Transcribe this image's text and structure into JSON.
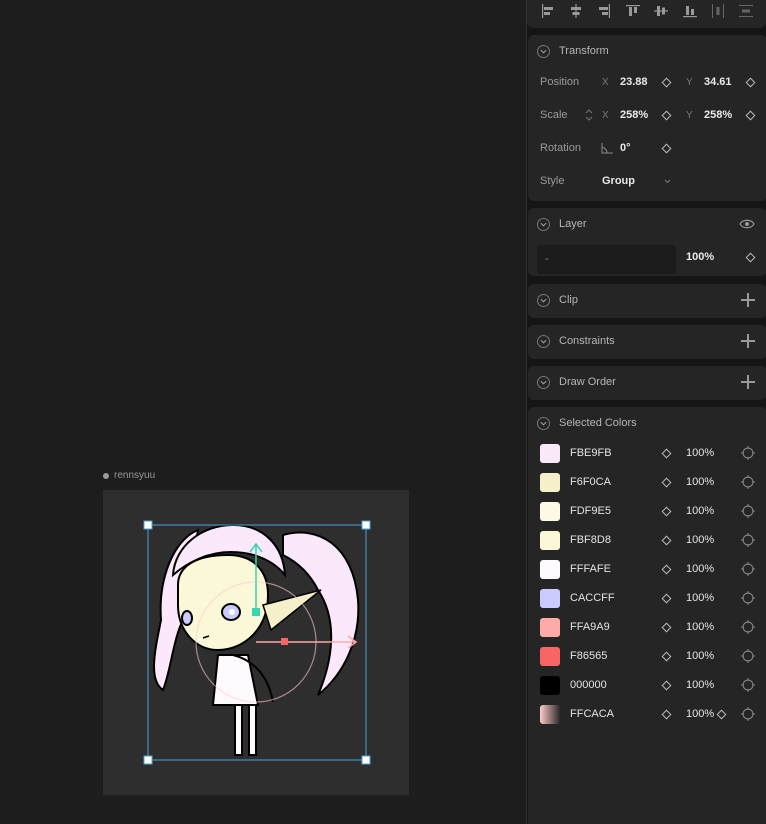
{
  "canvas": {
    "artboard_name": "rennsyuu"
  },
  "transform": {
    "title": "Transform",
    "position_label": "Position",
    "position_x_axis": "X",
    "position_x": "23.88",
    "position_y_axis": "Y",
    "position_y": "34.61",
    "scale_label": "Scale",
    "scale_x_axis": "X",
    "scale_x": "258%",
    "scale_y_axis": "Y",
    "scale_y": "258%",
    "rotation_label": "Rotation",
    "rotation": "0°",
    "style_label": "Style",
    "style": "Group"
  },
  "layer": {
    "title": "Layer",
    "blend": "-",
    "opacity": "100%"
  },
  "clip": {
    "title": "Clip"
  },
  "constraints": {
    "title": "Constraints"
  },
  "draw_order": {
    "title": "Draw Order"
  },
  "selected_colors": {
    "title": "Selected Colors",
    "items": [
      {
        "hex": "FBE9FB",
        "opacity": "100%",
        "color": "#FBE9FB"
      },
      {
        "hex": "F6F0CA",
        "opacity": "100%",
        "color": "#F6F0CA"
      },
      {
        "hex": "FDF9E5",
        "opacity": "100%",
        "color": "#FDF9E5"
      },
      {
        "hex": "FBF8D8",
        "opacity": "100%",
        "color": "#FBF8D8"
      },
      {
        "hex": "FFFAFE",
        "opacity": "100%",
        "color": "#FFFAFE"
      },
      {
        "hex": "CACCFF",
        "opacity": "100%",
        "color": "#CACCFF"
      },
      {
        "hex": "FFA9A9",
        "opacity": "100%",
        "color": "#FFA9A9"
      },
      {
        "hex": "F86565",
        "opacity": "100%",
        "color": "#F86565"
      },
      {
        "hex": "000000",
        "opacity": "100%",
        "color": "#000000"
      },
      {
        "hex": "FFCACA",
        "opacity": "100%",
        "color": "#FFCACA"
      }
    ]
  },
  "colors": {
    "accent": "#4aa3df",
    "bone_handle": "#35d6b0",
    "panel_bg": "#252525"
  }
}
